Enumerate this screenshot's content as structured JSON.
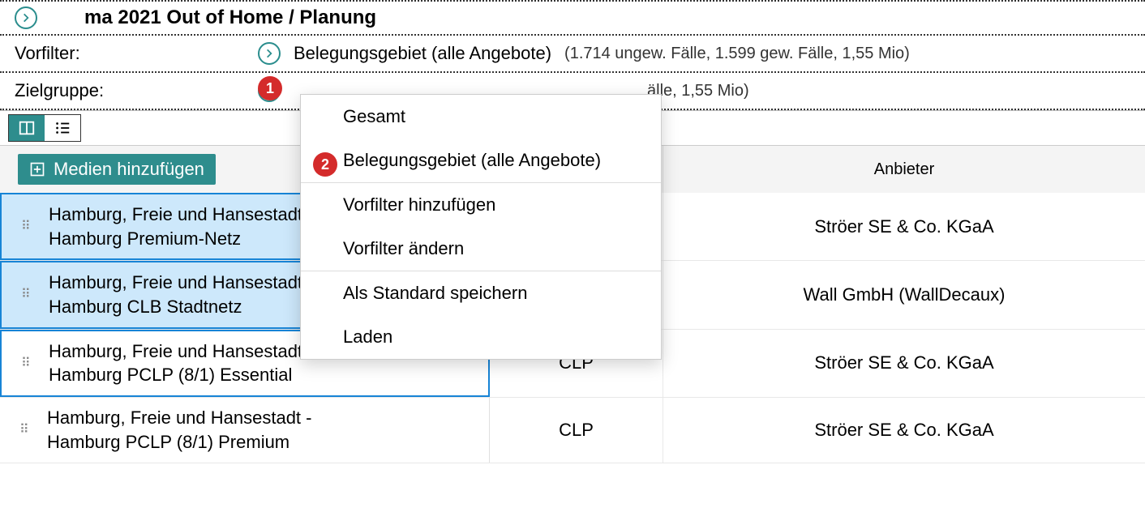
{
  "header": {
    "title": "ma 2021 Out of Home / Planung"
  },
  "filters": {
    "vorfilter": {
      "label": "Vorfilter:",
      "value": "Belegungsgebiet (alle Angebote)",
      "stats": "(1.714 ungew. Fälle, 1.599 gew. Fälle, 1,55 Mio)"
    },
    "zielgruppe": {
      "label": "Zielgruppe:",
      "value": "",
      "stats": "älle, 1,55 Mio)"
    }
  },
  "dropdown": {
    "items": [
      "Gesamt",
      "Belegungsgebiet (alle Angebote)",
      "Vorfilter hinzufügen",
      "Vorfilter ändern",
      "Als Standard speichern",
      "Laden"
    ]
  },
  "table": {
    "add_button": "Medien hinzufügen",
    "headers": {
      "provider": "Anbieter"
    },
    "rows": [
      {
        "media_line1": "Hamburg, Freie und Hansestadt -",
        "media_line2": "Hamburg Premium-Netz",
        "type": "",
        "provider": "Ströer SE & Co. KGaA",
        "selected": true
      },
      {
        "media_line1": "Hamburg, Freie und Hansestadt -",
        "media_line2": "Hamburg CLB Stadtnetz",
        "type": "",
        "provider": "Wall GmbH (WallDecaux)",
        "selected": true
      },
      {
        "media_line1": "Hamburg, Freie und Hansestadt -",
        "media_line2": "Hamburg PCLP (8/1) Essential",
        "type": "CLP",
        "provider": "Ströer SE & Co. KGaA",
        "selected": false,
        "highlight": true
      },
      {
        "media_line1": "Hamburg, Freie und Hansestadt -",
        "media_line2": "Hamburg PCLP (8/1) Premium",
        "type": "CLP",
        "provider": "Ströer SE & Co. KGaA",
        "selected": false
      }
    ]
  },
  "callouts": {
    "one": "1",
    "two": "2"
  }
}
